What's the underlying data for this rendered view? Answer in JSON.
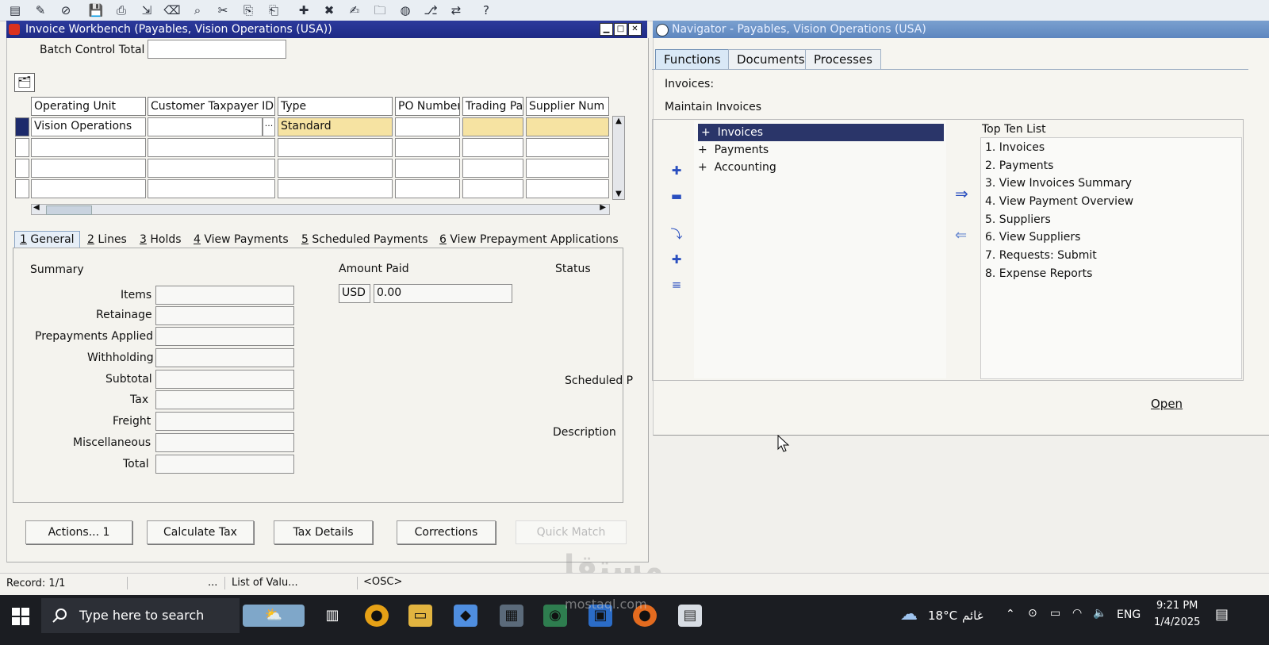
{
  "toolbar": {
    "icons": [
      "new-icon",
      "open-icon",
      "stop-icon",
      "save-icon",
      "print-icon",
      "exit-icon",
      "clear-icon",
      "find-icon",
      "cut-icon",
      "copy-icon",
      "paste-icon",
      "new-record-icon",
      "delete-record-icon",
      "edit-icon",
      "folder-icon",
      "web-icon",
      "attach-icon",
      "translate-icon",
      "help-icon"
    ]
  },
  "workbench": {
    "title": "Invoice Workbench (Payables, Vision Operations (USA))",
    "batch_control_total_label": "Batch Control Total",
    "batch_control_total_value": "",
    "grid": {
      "columns": [
        "Operating Unit",
        "Customer Taxpayer ID",
        "Type",
        "PO Number",
        "Trading Pa",
        "Supplier Num"
      ],
      "rows": [
        {
          "operating_unit": "Vision Operations",
          "customer_taxpayer_id": "",
          "type": "Standard",
          "po_number": "",
          "trading_partner": "",
          "supplier_num": ""
        }
      ]
    },
    "tabs": [
      {
        "num": "1",
        "label": "General"
      },
      {
        "num": "2",
        "label": "Lines"
      },
      {
        "num": "3",
        "label": "Holds"
      },
      {
        "num": "4",
        "label": "View Payments"
      },
      {
        "num": "5",
        "label": "Scheduled Payments"
      },
      {
        "num": "6",
        "label": "View Prepayment Applications"
      }
    ],
    "summary": {
      "heading": "Summary",
      "labels": [
        "Items",
        "Retainage",
        "Prepayments Applied",
        "Withholding",
        "Subtotal",
        "Tax",
        "Freight",
        "Miscellaneous",
        "Total"
      ]
    },
    "amount_paid": {
      "label": "Amount Paid",
      "currency": "USD",
      "value": "0.00"
    },
    "status_label": "Status",
    "scheduled_label": "Scheduled P",
    "description_label": "Description",
    "buttons": {
      "actions": "Actions... 1",
      "calculate_tax": "Calculate Tax",
      "tax_details": "Tax Details",
      "corrections": "Corrections",
      "quick_match": "Quick Match"
    }
  },
  "navigator": {
    "title": "Navigator - Payables, Vision Operations (USA)",
    "tabs": [
      "Functions",
      "Documents",
      "Processes"
    ],
    "context_label": "Invoices:",
    "context_value": "Maintain Invoices",
    "tree": [
      "Invoices",
      "Payments",
      "Accounting"
    ],
    "top_ten_label": "Top Ten List",
    "top_ten": [
      "1. Invoices",
      "2. Payments",
      "3. View Invoices Summary",
      "4. View Payment Overview",
      "5. Suppliers",
      "6. View Suppliers",
      "7. Requests: Submit",
      "8. Expense Reports"
    ],
    "open_label": "Open"
  },
  "statusbar": {
    "record": "Record: 1/1",
    "dots": "...",
    "list_of_values": "List of Valu...",
    "osc": "<OSC>"
  },
  "watermark": {
    "text": "مستقل",
    "sub": "mostaql.com"
  },
  "taskbar": {
    "search_placeholder": "Type here to search",
    "weather_temp": "18°C",
    "weather_text": "غائم",
    "language": "ENG",
    "time": "9:21 PM",
    "date": "1/4/2025"
  }
}
